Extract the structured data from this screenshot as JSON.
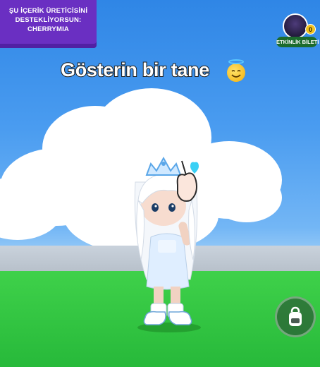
{
  "creator_badge": {
    "line1": "ŞU İÇERİK ÜRETİCİSİNİ",
    "line2": "DESTEKLİYORSUN:",
    "creator": "CHERRYMIA"
  },
  "event_ticket": {
    "label": "ETKİNLİK BİLETİ",
    "count": "0",
    "icon": "event-avatar-icon"
  },
  "caption": {
    "text": "Gösterin bir tane",
    "emoji": "smiling-face-with-halo-emoji"
  },
  "controls": {
    "backpack_icon": "backpack-icon"
  },
  "colors": {
    "badge_bg": "#6a2fc2",
    "ticket_label_bg": "#1c6b2d",
    "ticket_count_bg": "#f2c21f",
    "sky": "#3a8de8",
    "grass": "#33c742"
  }
}
